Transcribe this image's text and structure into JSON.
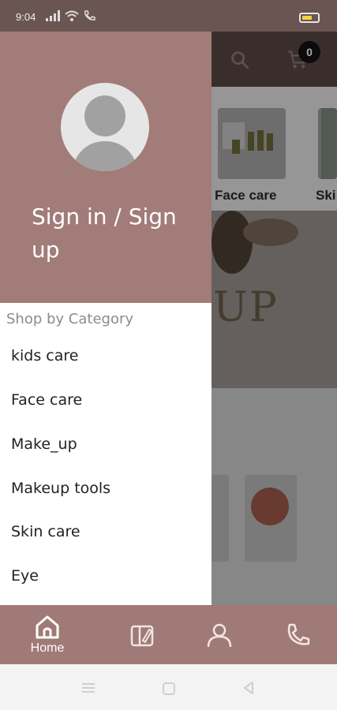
{
  "status_bar": {
    "time": "9:04"
  },
  "background": {
    "cart_count": "0",
    "category_labels": [
      "Face care",
      "Ski"
    ],
    "banner_text": "UP"
  },
  "drawer": {
    "auth_label": "Sign in / Sign up",
    "section_title": "Shop by Category",
    "categories": [
      "kids  care",
      "Face care",
      "Make_up",
      "Makeup  tools",
      "Skin care",
      "Eye"
    ]
  },
  "bottom_nav": {
    "home_label": "Home"
  },
  "colors": {
    "drawer_header": "#a27c78",
    "bottom_nav": "#a07a76",
    "status_bar": "#6b5553"
  }
}
